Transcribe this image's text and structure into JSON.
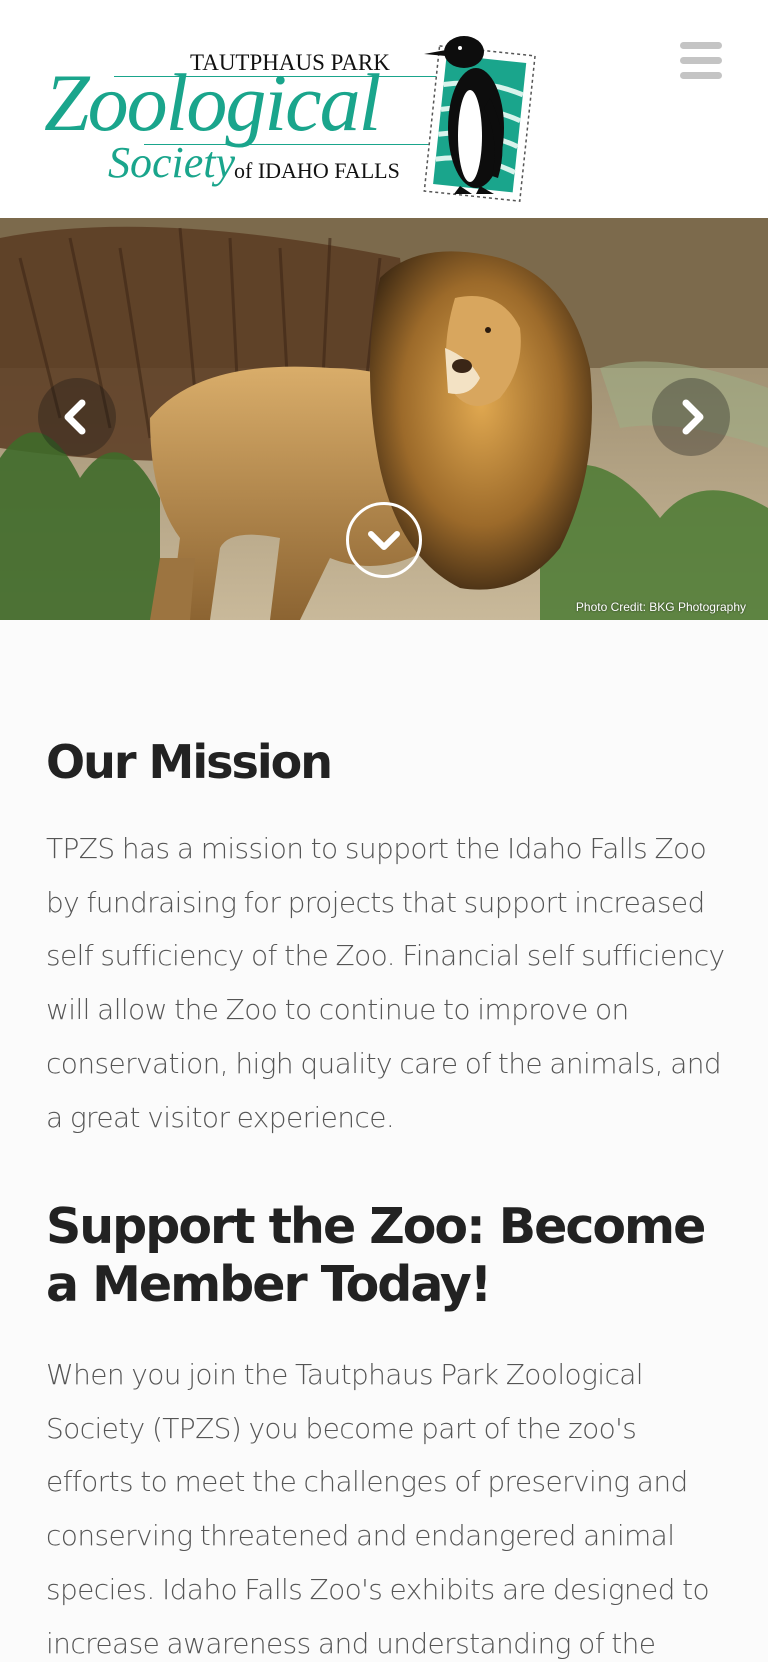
{
  "header": {
    "logo": {
      "line1": "TAUTPHAUS PARK",
      "line2": "Zoological",
      "line3": "Society",
      "line4": "of IDAHO FALLS",
      "mascot": "penguin-stamp",
      "brand_color": "#1aa58c"
    },
    "menu_icon": "hamburger-icon"
  },
  "hero": {
    "image": "lion-photo",
    "prev_icon": "chevron-left-icon",
    "next_icon": "chevron-right-icon",
    "scroll_icon": "chevron-down-circle-icon",
    "photo_credit": "Photo Credit: BKG Photography"
  },
  "mission": {
    "heading": "Our Mission",
    "text": "TPZS has a mission to support the Idaho Falls Zoo by fundraising for projects that support increased self sufficiency of the Zoo. Financial self sufficiency will allow the Zoo to continue to improve on conservation, high quality care of the animals, and a great visitor experience."
  },
  "support": {
    "heading": "Support the Zoo: Become a Member Today!",
    "text": "When you join the Tautphaus Park Zoological Society (TPZS) you become part of the zoo's efforts to meet the challenges of preserving and conserving threatened and endangered animal species. Idaho Falls Zoo's exhibits are designed to increase awareness and understanding of the"
  },
  "colors": {
    "page_background": "#fbfbfb",
    "heading": "#222222",
    "body_text": "#555555",
    "menu_icon": "#c4c4c4"
  }
}
